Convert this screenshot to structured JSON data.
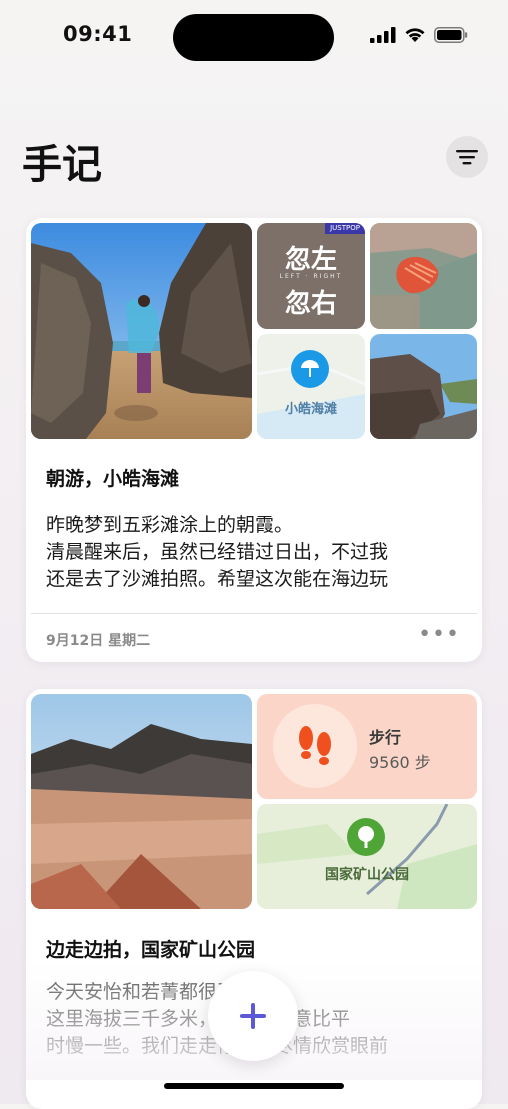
{
  "status_bar": {
    "time": "09:41"
  },
  "header": {
    "title": "手记"
  },
  "entries": [
    {
      "title": "朝游，小皓海滩",
      "lines": [
        "昨晚梦到五彩滩涂上的朝霞。",
        "清晨醒来后，虽然已经错过日出，不过我",
        "还是去了沙滩拍照。希望这次能在海边玩"
      ],
      "date": "9月12日 星期二",
      "more": "•••",
      "tiles": {
        "album_title_top": "忽左",
        "album_subtitle": "LEFT · RIGHT",
        "album_title_bottom": "忽右",
        "album_badge": "JUSTPOP",
        "map_location": "小皓海滩"
      }
    },
    {
      "title": "边走边拍，国家矿山公园",
      "lines": [
        "今天安怡和若菁都很开心！",
        "这里海拔三千多米，还是要注意比平",
        "时慢一些。我们走走停停，尽情欣赏眼前"
      ],
      "tiles": {
        "steps_label": "步行",
        "steps_value": "9560 步",
        "map_location": "国家矿山公园"
      }
    }
  ],
  "fab": {
    "label": "+"
  },
  "colors": {
    "accent": "#5b59d6",
    "steps_bg": "#fbd6c8",
    "steps_icon": "#f0501e",
    "map_green": "#4fa637"
  }
}
